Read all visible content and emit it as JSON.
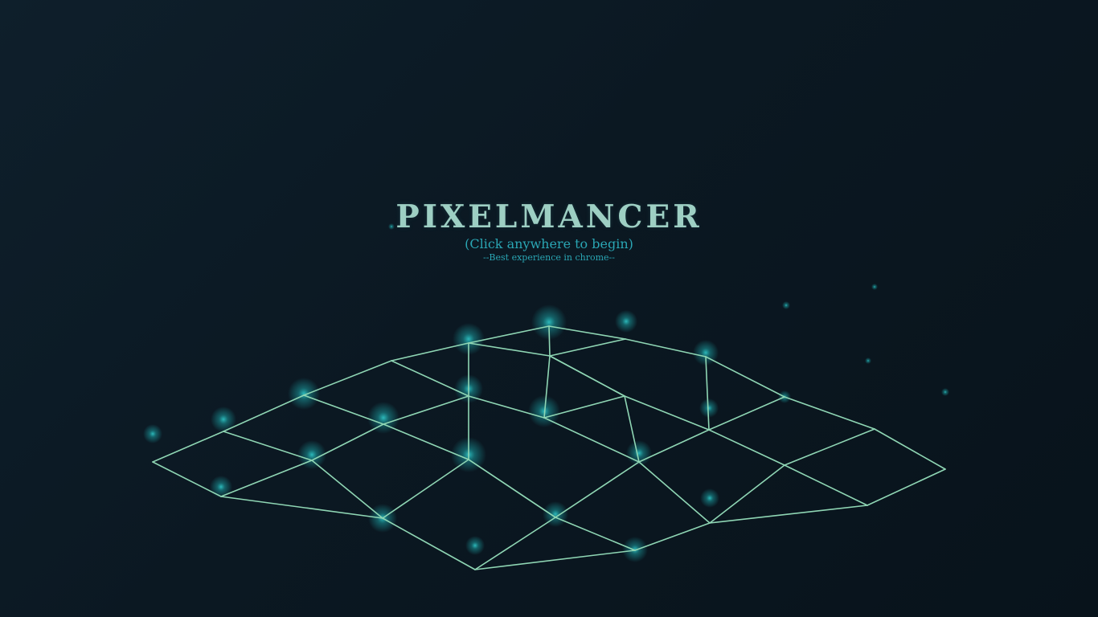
{
  "screen": {
    "title": "PIXELMANCER",
    "subtitle": "(Click anywhere to begin)",
    "hint": "--Best experience in chrome--"
  },
  "colors": {
    "background": "#0b1822",
    "title": "#9dcfc3",
    "accent": "#2aa6b4",
    "grid_line": "#8fd6b4",
    "glow": "#1fb6b8"
  }
}
